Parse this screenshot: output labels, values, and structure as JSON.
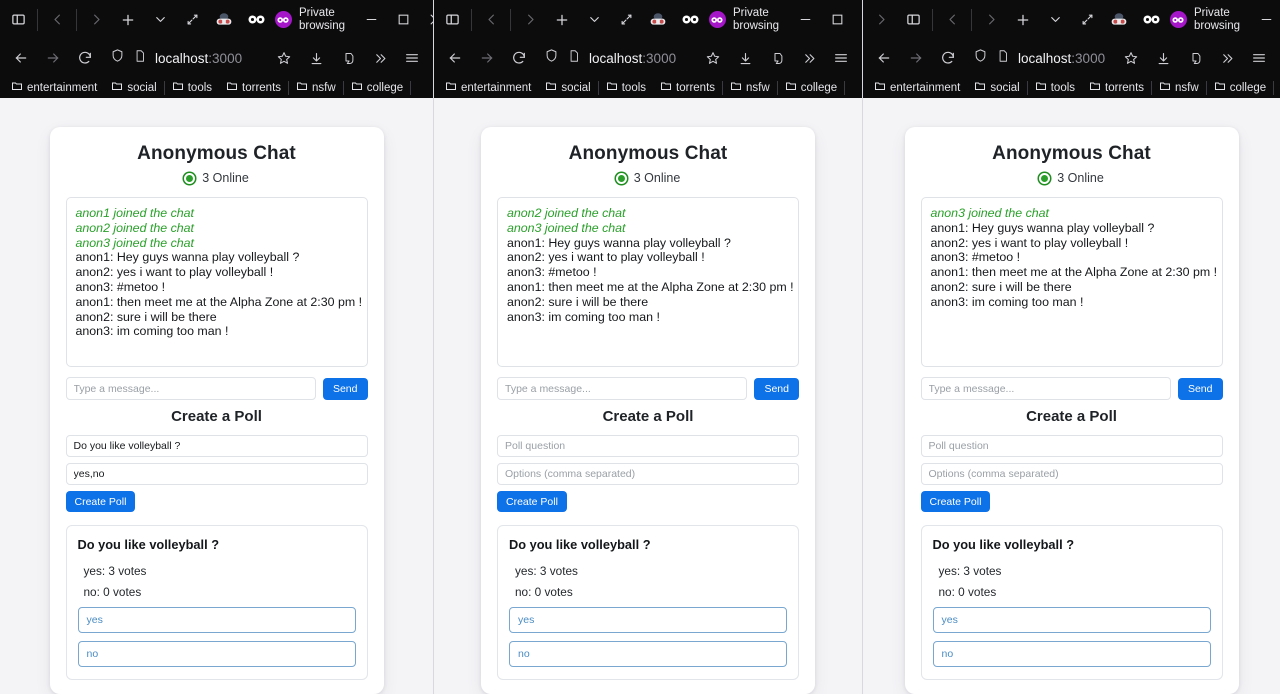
{
  "browser": {
    "private_label": "Private browsing",
    "url_host": "localhost",
    "url_port": ":3000",
    "bookmarks": [
      {
        "label": "entertainment"
      },
      {
        "label": "social"
      },
      {
        "label": "tools"
      },
      {
        "label": "torrents"
      },
      {
        "label": "nsfw"
      },
      {
        "label": "college"
      }
    ],
    "icons": {
      "sidebar": "sidebar-icon",
      "back": "back-arrow-icon",
      "forward": "forward-arrow-icon",
      "new_tab": "plus-icon",
      "list_all_tabs": "chevron-down-icon",
      "expand": "expand-icon",
      "container": "mask-avatar-icon",
      "extension": "infinity-icon",
      "private": "private-browsing-mask-icon",
      "minimize": "minimize-icon",
      "maximize": "maximize-icon",
      "close": "close-icon",
      "reload": "reload-icon",
      "shield": "shield-icon",
      "page": "page-icon",
      "bookmark_star": "star-icon",
      "downloads": "download-icon",
      "save_to_pocket": "pocket-icon",
      "overflow": "double-chevron-icon",
      "menu": "hamburger-menu-icon",
      "folder": "folder-icon"
    }
  },
  "app": {
    "title": "Anonymous Chat",
    "online_status": "3 Online",
    "message_placeholder": "Type a message...",
    "send_label": "Send",
    "poll_section_title": "Create a Poll",
    "poll_question_placeholder": "Poll question",
    "poll_options_placeholder": "Options (comma separated)",
    "create_poll_label": "Create Poll",
    "accent_color": "#0d71e8",
    "system_message_color": "#2aa02a",
    "vote_button_color": "#4a8cc4"
  },
  "windows": [
    {
      "id": "window-1",
      "messages": [
        {
          "text": "anon1 joined the chat",
          "system": true
        },
        {
          "text": "anon2 joined the chat",
          "system": true
        },
        {
          "text": "anon3 joined the chat",
          "system": true
        },
        {
          "text": "anon1: Hey guys wanna play volleyball ?",
          "system": false
        },
        {
          "text": "anon2: yes i want to play volleyball !",
          "system": false
        },
        {
          "text": "anon3: #metoo !",
          "system": false
        },
        {
          "text": "anon1: then meet me at the Alpha Zone at 2:30 pm !",
          "system": false
        },
        {
          "text": "anon2: sure i will be there",
          "system": false
        },
        {
          "text": "anon3: im coming too man !",
          "system": false
        }
      ],
      "message_input_value": "",
      "poll_question_value": "Do you like volleyball ?",
      "poll_options_value": "yes,no",
      "poll": {
        "question": "Do you like volleyball ?",
        "results": [
          {
            "label": "yes: 3 votes"
          },
          {
            "label": "no: 0 votes"
          }
        ],
        "options": [
          {
            "label": "yes"
          },
          {
            "label": "no"
          }
        ]
      }
    },
    {
      "id": "window-2",
      "messages": [
        {
          "text": "anon2 joined the chat",
          "system": true
        },
        {
          "text": "anon3 joined the chat",
          "system": true
        },
        {
          "text": "anon1: Hey guys wanna play volleyball ?",
          "system": false
        },
        {
          "text": "anon2: yes i want to play volleyball !",
          "system": false
        },
        {
          "text": "anon3: #metoo !",
          "system": false
        },
        {
          "text": "anon1: then meet me at the Alpha Zone at 2:30 pm !",
          "system": false
        },
        {
          "text": "anon2: sure i will be there",
          "system": false
        },
        {
          "text": "anon3: im coming too man !",
          "system": false
        }
      ],
      "message_input_value": "",
      "poll_question_value": "",
      "poll_options_value": "",
      "poll": {
        "question": "Do you like volleyball ?",
        "results": [
          {
            "label": "yes: 3 votes"
          },
          {
            "label": "no: 0 votes"
          }
        ],
        "options": [
          {
            "label": "yes"
          },
          {
            "label": "no"
          }
        ]
      }
    },
    {
      "id": "window-3",
      "messages": [
        {
          "text": "anon3 joined the chat",
          "system": true
        },
        {
          "text": "anon1: Hey guys wanna play volleyball ?",
          "system": false
        },
        {
          "text": "anon2: yes i want to play volleyball !",
          "system": false
        },
        {
          "text": "anon3: #metoo !",
          "system": false
        },
        {
          "text": "anon1: then meet me at the Alpha Zone at 2:30 pm !",
          "system": false
        },
        {
          "text": "anon2: sure i will be there",
          "system": false
        },
        {
          "text": "anon3: im coming too man !",
          "system": false
        }
      ],
      "message_input_value": "",
      "poll_question_value": "",
      "poll_options_value": "",
      "poll": {
        "question": "Do you like volleyball ?",
        "results": [
          {
            "label": "yes: 3 votes"
          },
          {
            "label": "no: 0 votes"
          }
        ],
        "options": [
          {
            "label": "yes"
          },
          {
            "label": "no"
          }
        ]
      }
    }
  ]
}
